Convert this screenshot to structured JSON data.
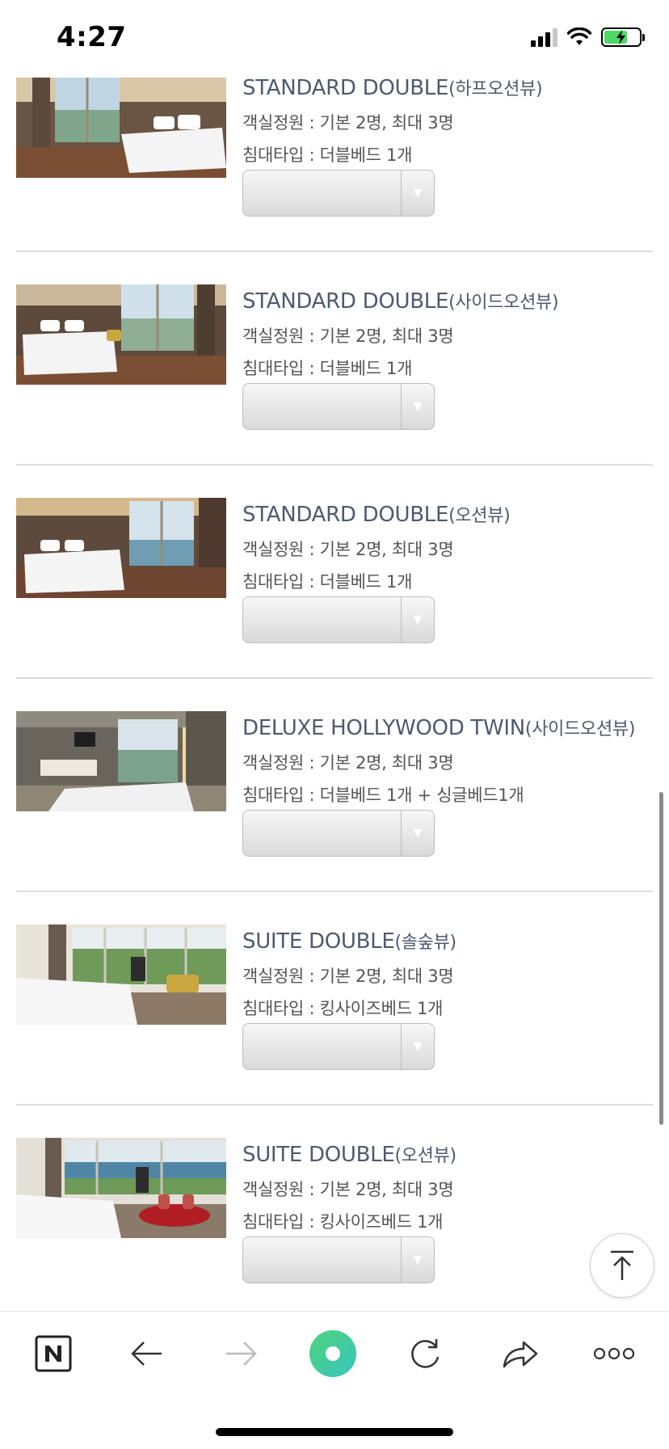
{
  "status_bar": {
    "time": "4:27"
  },
  "rooms": [
    {
      "name": "STANDARD DOUBLE",
      "view": "(하프오션뷰)",
      "capacity": "객실정원 : 기본 2명, 최대 3명",
      "bed": "침대타입 : 더블베드 1개"
    },
    {
      "name": "STANDARD DOUBLE",
      "view": "(사이드오션뷰)",
      "capacity": "객실정원 : 기본 2명, 최대 3명",
      "bed": "침대타입 : 더블베드 1개"
    },
    {
      "name": "STANDARD DOUBLE",
      "view": "(오션뷰)",
      "capacity": "객실정원 : 기본 2명, 최대 3명",
      "bed": "침대타입 : 더블베드 1개"
    },
    {
      "name": "DELUXE HOLLYWOOD TWIN",
      "view": "(사이드오션뷰)",
      "capacity": "객실정원 : 기본 2명, 최대 3명",
      "bed": "침대타입 : 더블베드 1개 + 싱글베드1개"
    },
    {
      "name": "SUITE DOUBLE",
      "view": "(솔숲뷰)",
      "capacity": "객실정원 : 기본 2명, 최대 3명",
      "bed": "침대타입 : 킹사이즈베드 1개"
    },
    {
      "name": "SUITE DOUBLE",
      "view": "(오션뷰)",
      "capacity": "객실정원 : 기본 2명, 최대 3명",
      "bed": "침대타입 : 킹사이즈베드 1개"
    }
  ],
  "toolbar": {
    "items": [
      "naver-home-icon",
      "back-arrow-icon",
      "forward-arrow-icon",
      "green-dot-icon",
      "refresh-icon",
      "share-icon",
      "more-icon"
    ],
    "accent": "#3ecf8e"
  },
  "colors": {
    "room_name": "#4d5a6e",
    "divider": "#dcdcdc"
  }
}
